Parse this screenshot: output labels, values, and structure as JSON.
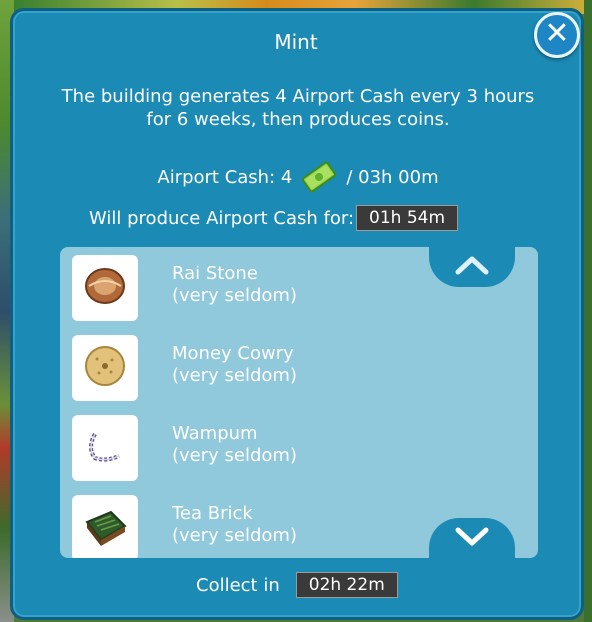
{
  "dialog": {
    "title": "Mint",
    "description_line1": "The building generates 4 Airport Cash every 3 hours",
    "description_line2": "for 6 weeks, then produces coins.",
    "cash_label": "Airport Cash: 4",
    "cash_rate": "/ 03h 00m",
    "produce_label": "Will produce Airport Cash for:",
    "produce_timer": "01h 54m",
    "collect_label": "Collect in",
    "collect_timer": "02h 22m"
  },
  "items": [
    {
      "name": "Rai Stone",
      "frequency": "(very seldom)",
      "icon": "rai-stone-icon"
    },
    {
      "name": "Money Cowry",
      "frequency": "(very seldom)",
      "icon": "money-cowry-icon"
    },
    {
      "name": "Wampum",
      "frequency": "(very seldom)",
      "icon": "wampum-icon"
    },
    {
      "name": "Tea Brick",
      "frequency": "(very seldom)",
      "icon": "tea-brick-icon"
    }
  ],
  "colors": {
    "panel": "#1b8ab4",
    "list_bg": "#90c8dc",
    "timer_bg": "#3a3a3a"
  }
}
